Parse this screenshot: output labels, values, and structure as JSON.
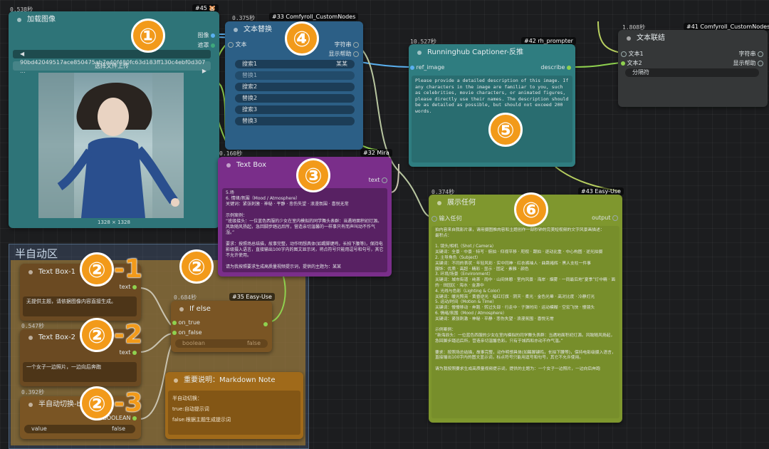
{
  "badges": {
    "b1": "①",
    "b2": "②",
    "b3": "③",
    "b4": "④",
    "b5": "⑤",
    "b6": "⑥",
    "b21_num": "②",
    "b21_suffix": "-1",
    "b22_num": "②",
    "b22_suffix": "-2",
    "b23_num": "②",
    "b23_suffix": "-3"
  },
  "group": {
    "title": "半自动区"
  },
  "load_image": {
    "timing": "0.538秒",
    "id": "#45",
    "title": "加载图像",
    "out_image": "图像",
    "out_mask": "遮罩",
    "filename": "90bd42049517ace850475ab7e40f480fc63d183ff130c4ebf0d307 ...",
    "upload_label": "选择文件上传",
    "image_size": "1328 × 1328"
  },
  "text_replace": {
    "timing": "0.375秒",
    "id": "#33 Comfyroll_CustomNodes",
    "title": "文本替换",
    "in_text": "文本",
    "out_string": "字符串",
    "out_help": "显示帮助",
    "fields": [
      "搜索1",
      "替换1",
      "搜索2",
      "替换2",
      "搜索3",
      "替换3"
    ],
    "search1_value": "某某"
  },
  "text_box_mira": {
    "timing": "0.160秒",
    "id": "#32 Mira",
    "title": "Text Box",
    "out_text": "text",
    "body": "5.场\n6. 情绪/氛围（Mood / Atmosphere）\n关键词：紧张刺激 · 神秘 · 平静 · 悲伤失望 · 浪漫氛围 · 喜悦无常\n\n示例案例：\n“班级接头：一位蓝色西服的少女在室内模拟的同学舞头表群：当遇地面积初灯源。风致随风扬起，急回脚步踏远后所，营造亲切温馨的一样事只有而声叫动不作气湿。”\n\n要求：按照场总结描，故事完整，动作明想具体(如踢脚键鸣，长拍下腰等)，保持电影级摄入语言，直接输出100字内的图文显示词，将点符号只能用逗号和句号，其它不允许使用。\n\n请为我按照要求生成高质量视频提示词，提供的主题为：某某"
  },
  "captioner": {
    "timing": "10.527秒",
    "id": "#42 rh_prompter",
    "title": "Runninghub Captioner-反推",
    "in_ref": "ref_image",
    "out_desc": "describe",
    "prompt": "Please provide a detailed description of this image. If any characters in the image are familiar to you, such as celebrities, movie characters, or animated figures, please directly use their names. The description should be as detailed as possible, but should not exceed 200 words."
  },
  "concat": {
    "timing": "1.808秒",
    "id": "#41 Comfyroll_CustomNodes",
    "title": "文本联结",
    "in_text1": "文本1",
    "in_text2": "文本2",
    "out_string": "字符串",
    "out_help": "显示帮助",
    "separator": "分隔符"
  },
  "show_any": {
    "timing": "0.374秒",
    "id": "#43 Easy-Use",
    "title": "展示任何",
    "in_any": "输入任何",
    "out_output": "output",
    "body": "拍内容来自我影片录，请用摄图推肉容和主题创作一部秒钟的完美短视频的文字风景画描述：\n最积点：\n\n1. 镜头/相机（Shot / Camera）\n关键词：全景 · 中景 · 特写 · 俯拍 · 仰视平移 · 咫视 · 跟拍 · 逐动比重 · 中心构图 · 逆光拍摄\n2. 主导角色（Subject）\n关键词：不同的表状 · 年轻风彩 · 实中同神 · 红衣裤袖人 · 曲跳褚辉 · 黑人支柱一件事\n服饰：优质 · 高超 · 精彩 · 显示 · 固定 · 素雅 · 颜色\n3. 环境/场景（Environment）\n关键词：城市街道 · 纯茶 · 雨中 · 山间休憩 · 室内风景 · 海岸 · 烟雾 · 一同最后地“夏季”灯中精 · 面的 · 田园区 · 海水 · 金源中\n4. 光线与色彩（Lighting & Color）\n关键词：暖光照亮 · 黄昏逆光 · 暗红灯旗 · 阴天 · 柔光 · 金色光晕 · 高对比度 · 冷静灯光\n5. 运动/时间（Motion & Time）\n关键词：慢慢移动 · 奔跑 · 转过头部 · 行走中 · 子弹时间 · 运动模糊 · 空宏飞快 · 慢镜头\n6. 情绪/氛围（Mood / Atmosphere）\n关键词：紧张刺激 · 神秘 · 平静 · 悲伤失望 · 浪漫氛围 · 喜悦无常\n\n示例案例：\n“新海辰头：一位蓝色西服的少女在室内模拟的同学舞头表群：当遇地面积初灯源。风致随风扬起，急回脚步踏远后所，营造亲切温馨色彩。只有于城西和亦动不作气温。”\n\n要求：按照场总结描，故事完整，动作明想具体(如踢脚键鸣，长拍下腰等)，保持电影级摄入语言，直接输出100字内的图文显示词，标点符号只能用逗号和句号，其它不允许使用。\n\n请为我按照要求生成高质量视频提示词，提供的主题为：一个女子一边照片，一边向后奔跑"
  },
  "tb1": {
    "title": "Text Box-1",
    "out_text": "text",
    "body": "无提供主题，请依据图像内容直接生成。"
  },
  "tb2": {
    "timing": "0.547秒",
    "title": "Text Box-2",
    "out_text": "text",
    "body": "一个女子一边照片，一边向后奔跑"
  },
  "if_else": {
    "timing": "0.684秒",
    "id": "#35 Easy-Use",
    "title": "If else",
    "in_true": "on_true",
    "in_false": "on_false",
    "in_bool": "boolean",
    "bool_value": "false"
  },
  "switch": {
    "timing": "0.392秒",
    "title": "半自动切换-b",
    "out_bool": "BOOLEAN",
    "widget_label": "value",
    "widget_value": "false"
  },
  "note": {
    "title": "重要说明：Markdown Note",
    "line1": "半自动切换：",
    "line2": "true:自动提示词",
    "line3": "false:根据主题生成提示词"
  },
  "colors": {
    "teal": "#2f7d80",
    "blue": "#2c5f86",
    "purple": "#7a2e8a",
    "olive": "#7f972e",
    "brown": "#6b4a22",
    "orange": "#a06a1a",
    "badge": "#f29a1a"
  }
}
